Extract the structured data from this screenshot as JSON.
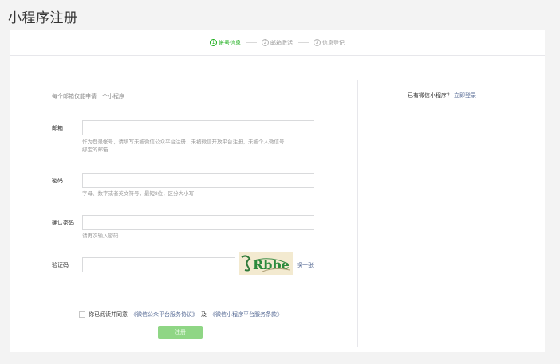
{
  "page": {
    "title": "小程序注册"
  },
  "steps": [
    {
      "num": "1",
      "label": "帐号信息",
      "active": true
    },
    {
      "num": "2",
      "label": "邮箱激活",
      "active": false
    },
    {
      "num": "3",
      "label": "信息登记",
      "active": false
    }
  ],
  "form": {
    "notice": "每个邮箱仅能申请一个小程序",
    "email": {
      "label": "邮箱",
      "value": "",
      "placeholder": "",
      "hint_line1": "作为登录帐号，请填写未被微信公众平台注册，未被微信开放平台注册，未被个人微信号",
      "hint_line2": "绑定的邮箱"
    },
    "password": {
      "label": "密码",
      "value": "",
      "hint": "字母、数字或者英文符号，最短8位，区分大小写"
    },
    "confirm_password": {
      "label": "确认密码",
      "value": "",
      "hint": "请再次输入密码"
    },
    "captcha": {
      "label": "验证码",
      "value": "",
      "image_text": "Rbbe",
      "refresh_label": "换一张"
    },
    "agreement": {
      "prefix": "你已阅读并同意",
      "link1": "《微信公众平台服务协议》",
      "joiner": "及",
      "link2": "《微信小程序平台服务条款》",
      "checked": false
    },
    "submit_label": "注册"
  },
  "side": {
    "question": "已有微信小程序？",
    "login_link": "立即登录"
  },
  "colors": {
    "accent_green": "#1aad19",
    "link_blue": "#576b95",
    "disabled_button": "#8fd685"
  }
}
